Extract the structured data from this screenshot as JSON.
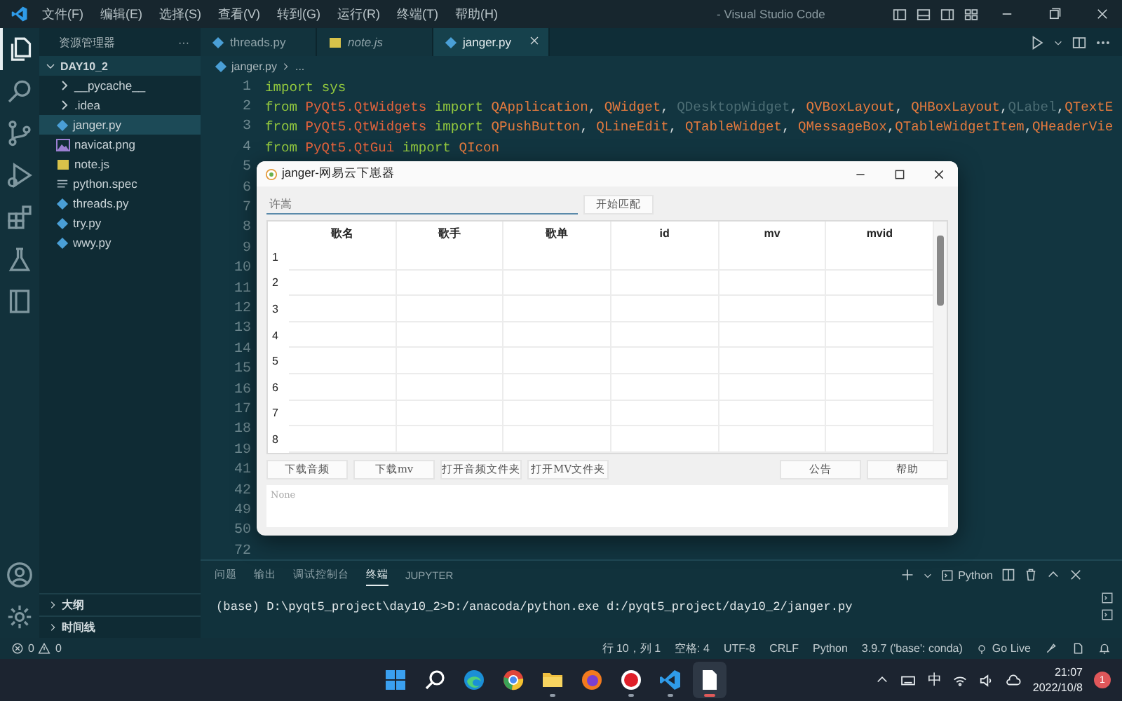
{
  "titlebar": {
    "menus": [
      "文件(F)",
      "编辑(E)",
      "选择(S)",
      "查看(V)",
      "转到(G)",
      "运行(R)",
      "终端(T)",
      "帮助(H)"
    ],
    "title": "- Visual Studio Code"
  },
  "activity_bar": {
    "items": [
      {
        "kind": "files",
        "selected": true
      },
      {
        "kind": "search",
        "selected": false
      },
      {
        "kind": "branch",
        "selected": false
      },
      {
        "kind": "debug",
        "selected": false
      },
      {
        "kind": "blocks",
        "selected": false
      },
      {
        "kind": "flask",
        "selected": false
      },
      {
        "kind": "book",
        "selected": false
      }
    ],
    "bottom": [
      {
        "kind": "account"
      },
      {
        "kind": "gear"
      }
    ]
  },
  "sidebar": {
    "title": "资源管理器",
    "more": "···",
    "folder": "DAY10_2",
    "items": [
      {
        "label": "__pycache__",
        "kind": "folder",
        "selected": false
      },
      {
        "label": ".idea",
        "kind": "folder",
        "selected": false
      },
      {
        "label": "janger.py",
        "kind": "python",
        "selected": true
      },
      {
        "label": "navicat.png",
        "kind": "image",
        "selected": false
      },
      {
        "label": "note.js",
        "kind": "js",
        "selected": false
      },
      {
        "label": "python.spec",
        "kind": "text",
        "selected": false
      },
      {
        "label": "threads.py",
        "kind": "python",
        "selected": false
      },
      {
        "label": "try.py",
        "kind": "python",
        "selected": false
      },
      {
        "label": "wwy.py",
        "kind": "python",
        "selected": false
      }
    ],
    "sections": [
      "大纲",
      "时间线"
    ]
  },
  "editor": {
    "tabs": [
      {
        "label": "threads.py",
        "kind": "python",
        "selected": false
      },
      {
        "label": "note.js",
        "kind": "js",
        "selected": false
      },
      {
        "label": "janger.py",
        "kind": "python",
        "selected": true
      }
    ],
    "breadcrumb": [
      "janger.py",
      "..."
    ],
    "lines": [
      {
        "number": "1",
        "tokens": [
          {
            "text": "import ",
            "kind": "kw"
          },
          {
            "text": "sys",
            "kind": "kw"
          }
        ]
      },
      {
        "number": "2",
        "tokens": [
          {
            "text": "from ",
            "kind": "kw"
          },
          {
            "text": "PyQt5.QtWidgets ",
            "kind": "mod"
          },
          {
            "text": "import ",
            "kind": "kw"
          },
          {
            "text": "QApplication",
            "kind": "cls"
          },
          {
            "text": ", ",
            "kind": "punct"
          },
          {
            "text": "QWidget",
            "kind": "cls"
          },
          {
            "text": ", ",
            "kind": "punct"
          },
          {
            "text": "QDesktopWidget",
            "kind": "dim"
          },
          {
            "text": ", ",
            "kind": "punct"
          },
          {
            "text": "QVBoxLayout",
            "kind": "cls"
          },
          {
            "text": ", ",
            "kind": "punct"
          },
          {
            "text": "QHBoxLayout",
            "kind": "cls"
          },
          {
            "text": ",",
            "kind": "punct"
          },
          {
            "text": "QLabel",
            "kind": "dim"
          },
          {
            "text": ",",
            "kind": "punct"
          },
          {
            "text": "QTextE",
            "kind": "cls"
          }
        ]
      },
      {
        "number": "3",
        "tokens": [
          {
            "text": "from ",
            "kind": "kw"
          },
          {
            "text": "PyQt5.QtWidgets ",
            "kind": "mod"
          },
          {
            "text": "import ",
            "kind": "kw"
          },
          {
            "text": "QPushButton",
            "kind": "cls"
          },
          {
            "text": ", ",
            "kind": "punct"
          },
          {
            "text": "QLineEdit",
            "kind": "cls"
          },
          {
            "text": ", ",
            "kind": "punct"
          },
          {
            "text": "QTableWidget",
            "kind": "cls"
          },
          {
            "text": ", ",
            "kind": "punct"
          },
          {
            "text": "QMessageBox",
            "kind": "cls"
          },
          {
            "text": ",",
            "kind": "punct"
          },
          {
            "text": "QTableWidgetItem",
            "kind": "cls"
          },
          {
            "text": ",",
            "kind": "punct"
          },
          {
            "text": "QHeaderVie",
            "kind": "cls"
          }
        ]
      },
      {
        "number": "4",
        "tokens": [
          {
            "text": "from ",
            "kind": "kw"
          },
          {
            "text": "PyQt5.QtGui ",
            "kind": "mod"
          },
          {
            "text": "import ",
            "kind": "kw"
          },
          {
            "text": "QIcon",
            "kind": "cls"
          }
        ]
      },
      {
        "number": "5"
      },
      {
        "number": "6"
      },
      {
        "number": "7"
      },
      {
        "number": "8"
      },
      {
        "number": "9"
      },
      {
        "number": "10"
      },
      {
        "number": "11"
      },
      {
        "number": "12"
      },
      {
        "number": "13"
      },
      {
        "number": "14"
      },
      {
        "number": "15"
      },
      {
        "number": "16"
      },
      {
        "number": "17"
      },
      {
        "number": "18"
      },
      {
        "number": "19"
      },
      {
        "number": "41"
      },
      {
        "number": "42"
      },
      {
        "number": "49"
      },
      {
        "number": "50"
      },
      {
        "number": "72"
      }
    ]
  },
  "dialog": {
    "title": "janger-网易云下崽器",
    "search": {
      "value": "许嵩"
    },
    "match_button": "开始匹配",
    "table": {
      "columns": [
        "歌名",
        "歌手",
        "歌单",
        "id",
        "mv",
        "mvid"
      ],
      "rows": [
        "1",
        "2",
        "3",
        "4",
        "5",
        "6",
        "7",
        "8"
      ]
    },
    "buttons_left": [
      "下载音频",
      "下载mv",
      "打开音频文件夹",
      "打开MV文件夹"
    ],
    "buttons_right": [
      "公告",
      "帮助"
    ],
    "output": {
      "placeholder": "None"
    }
  },
  "panel": {
    "tabs": [
      {
        "label": "问题",
        "selected": false
      },
      {
        "label": "输出",
        "selected": false
      },
      {
        "label": "调试控制台",
        "selected": false
      },
      {
        "label": "终端",
        "selected": true
      },
      {
        "label": "JUPYTER",
        "selected": false
      }
    ],
    "profile": "Python",
    "terminal": "(base) D:\\pyqt5_project\\day10_2>D:/anacoda/python.exe d:/pyqt5_project/day10_2/janger.py"
  },
  "status_bar": {
    "errors": "0",
    "warnings": "0",
    "items": [
      "行 10，列 1",
      "空格: 4",
      "UTF-8",
      "CRLF",
      "Python",
      "3.9.7 ('base': conda)",
      "Go Live"
    ]
  },
  "taskbar": {
    "apps": [
      {
        "kind": "start",
        "selected": false,
        "running": false
      },
      {
        "kind": "search",
        "selected": false,
        "running": false
      },
      {
        "kind": "edge",
        "selected": false,
        "running": false
      },
      {
        "kind": "chrome",
        "selected": false,
        "running": false
      },
      {
        "kind": "folder",
        "selected": false,
        "running": true
      },
      {
        "kind": "firefox",
        "selected": false,
        "running": false
      },
      {
        "kind": "record",
        "selected": false,
        "running": true
      },
      {
        "kind": "vscode",
        "selected": false,
        "running": true
      },
      {
        "kind": "file",
        "selected": true,
        "running": true
      }
    ],
    "ime": "中",
    "time": "21:07",
    "date": "2022/10/8",
    "badge": "1"
  }
}
